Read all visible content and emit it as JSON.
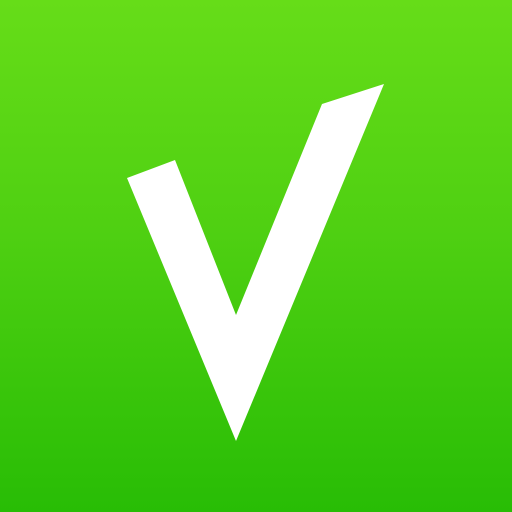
{
  "app_icon": {
    "icon": "checkmark-v-icon",
    "colors": {
      "background_top": "#66dd18",
      "background_mid": "#4fd012",
      "background_bottom": "#28bd05",
      "mark": "#ffffff"
    }
  }
}
